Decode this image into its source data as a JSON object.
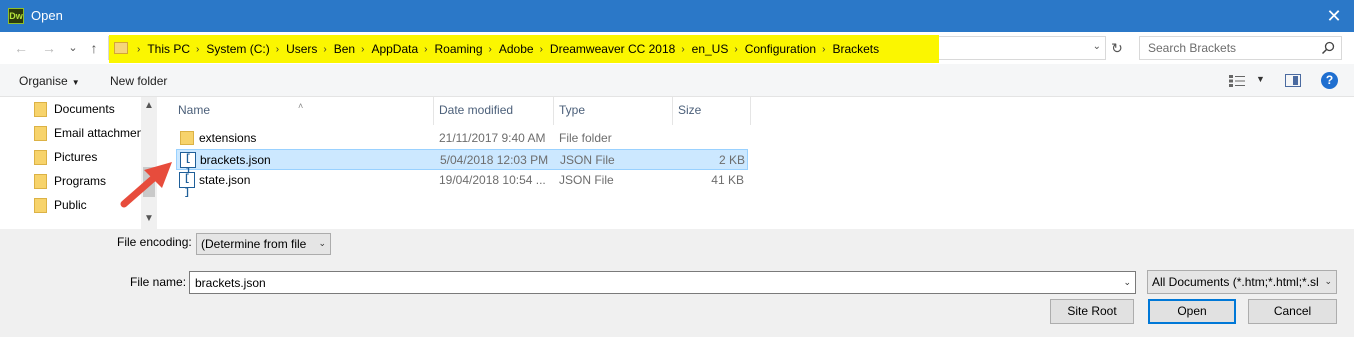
{
  "window": {
    "app_icon_text": "Dw",
    "title": "Open",
    "close_glyph": "✕"
  },
  "navigation": {
    "back_glyph": "←",
    "forward_glyph": "→",
    "recent_glyph": "⌄",
    "up_glyph": "↑",
    "refresh_glyph": "↻"
  },
  "address": {
    "crumbs": [
      "This PC",
      "System (C:)",
      "Users",
      "Ben",
      "AppData",
      "Roaming",
      "Adobe",
      "Dreamweaver CC 2018",
      "en_US",
      "Configuration",
      "Brackets"
    ],
    "separator": "›",
    "dropdown_glyph": "⌄",
    "highlight_color": "#fbf600"
  },
  "search": {
    "placeholder": "Search Brackets"
  },
  "toolbar": {
    "organise_label": "Organise",
    "new_folder_label": "New folder",
    "help_glyph": "?"
  },
  "nav_pane": {
    "items": [
      "Documents",
      "Email attachments",
      "Pictures",
      "Programs",
      "Public"
    ]
  },
  "file_list": {
    "columns": {
      "name": "Name",
      "date": "Date modified",
      "type": "Type",
      "size": "Size"
    },
    "rows": [
      {
        "name": "extensions",
        "date": "21/11/2017 9:40 AM",
        "type": "File folder",
        "size": "",
        "icon": "folder-icon",
        "selected": false
      },
      {
        "name": "brackets.json",
        "date": "5/04/2018 12:03 PM",
        "type": "JSON File",
        "size": "2 KB",
        "icon": "json-file-icon",
        "selected": true
      },
      {
        "name": "state.json",
        "date": "19/04/2018 10:54 ...",
        "type": "JSON File",
        "size": "41 KB",
        "icon": "json-file-icon",
        "selected": false
      }
    ]
  },
  "bottom": {
    "encoding_label": "File encoding:",
    "encoding_value": "(Determine from file",
    "file_name_label": "File name:",
    "file_name_value": "brackets.json",
    "file_type_value": "All Documents (*.htm;*.html;*.shtm",
    "site_root_label": "Site Root",
    "open_label": "Open",
    "cancel_label": "Cancel"
  },
  "colors": {
    "titlebar": "#2b78c8",
    "selection": "#cce8ff",
    "arrow": "#e74c3c"
  }
}
